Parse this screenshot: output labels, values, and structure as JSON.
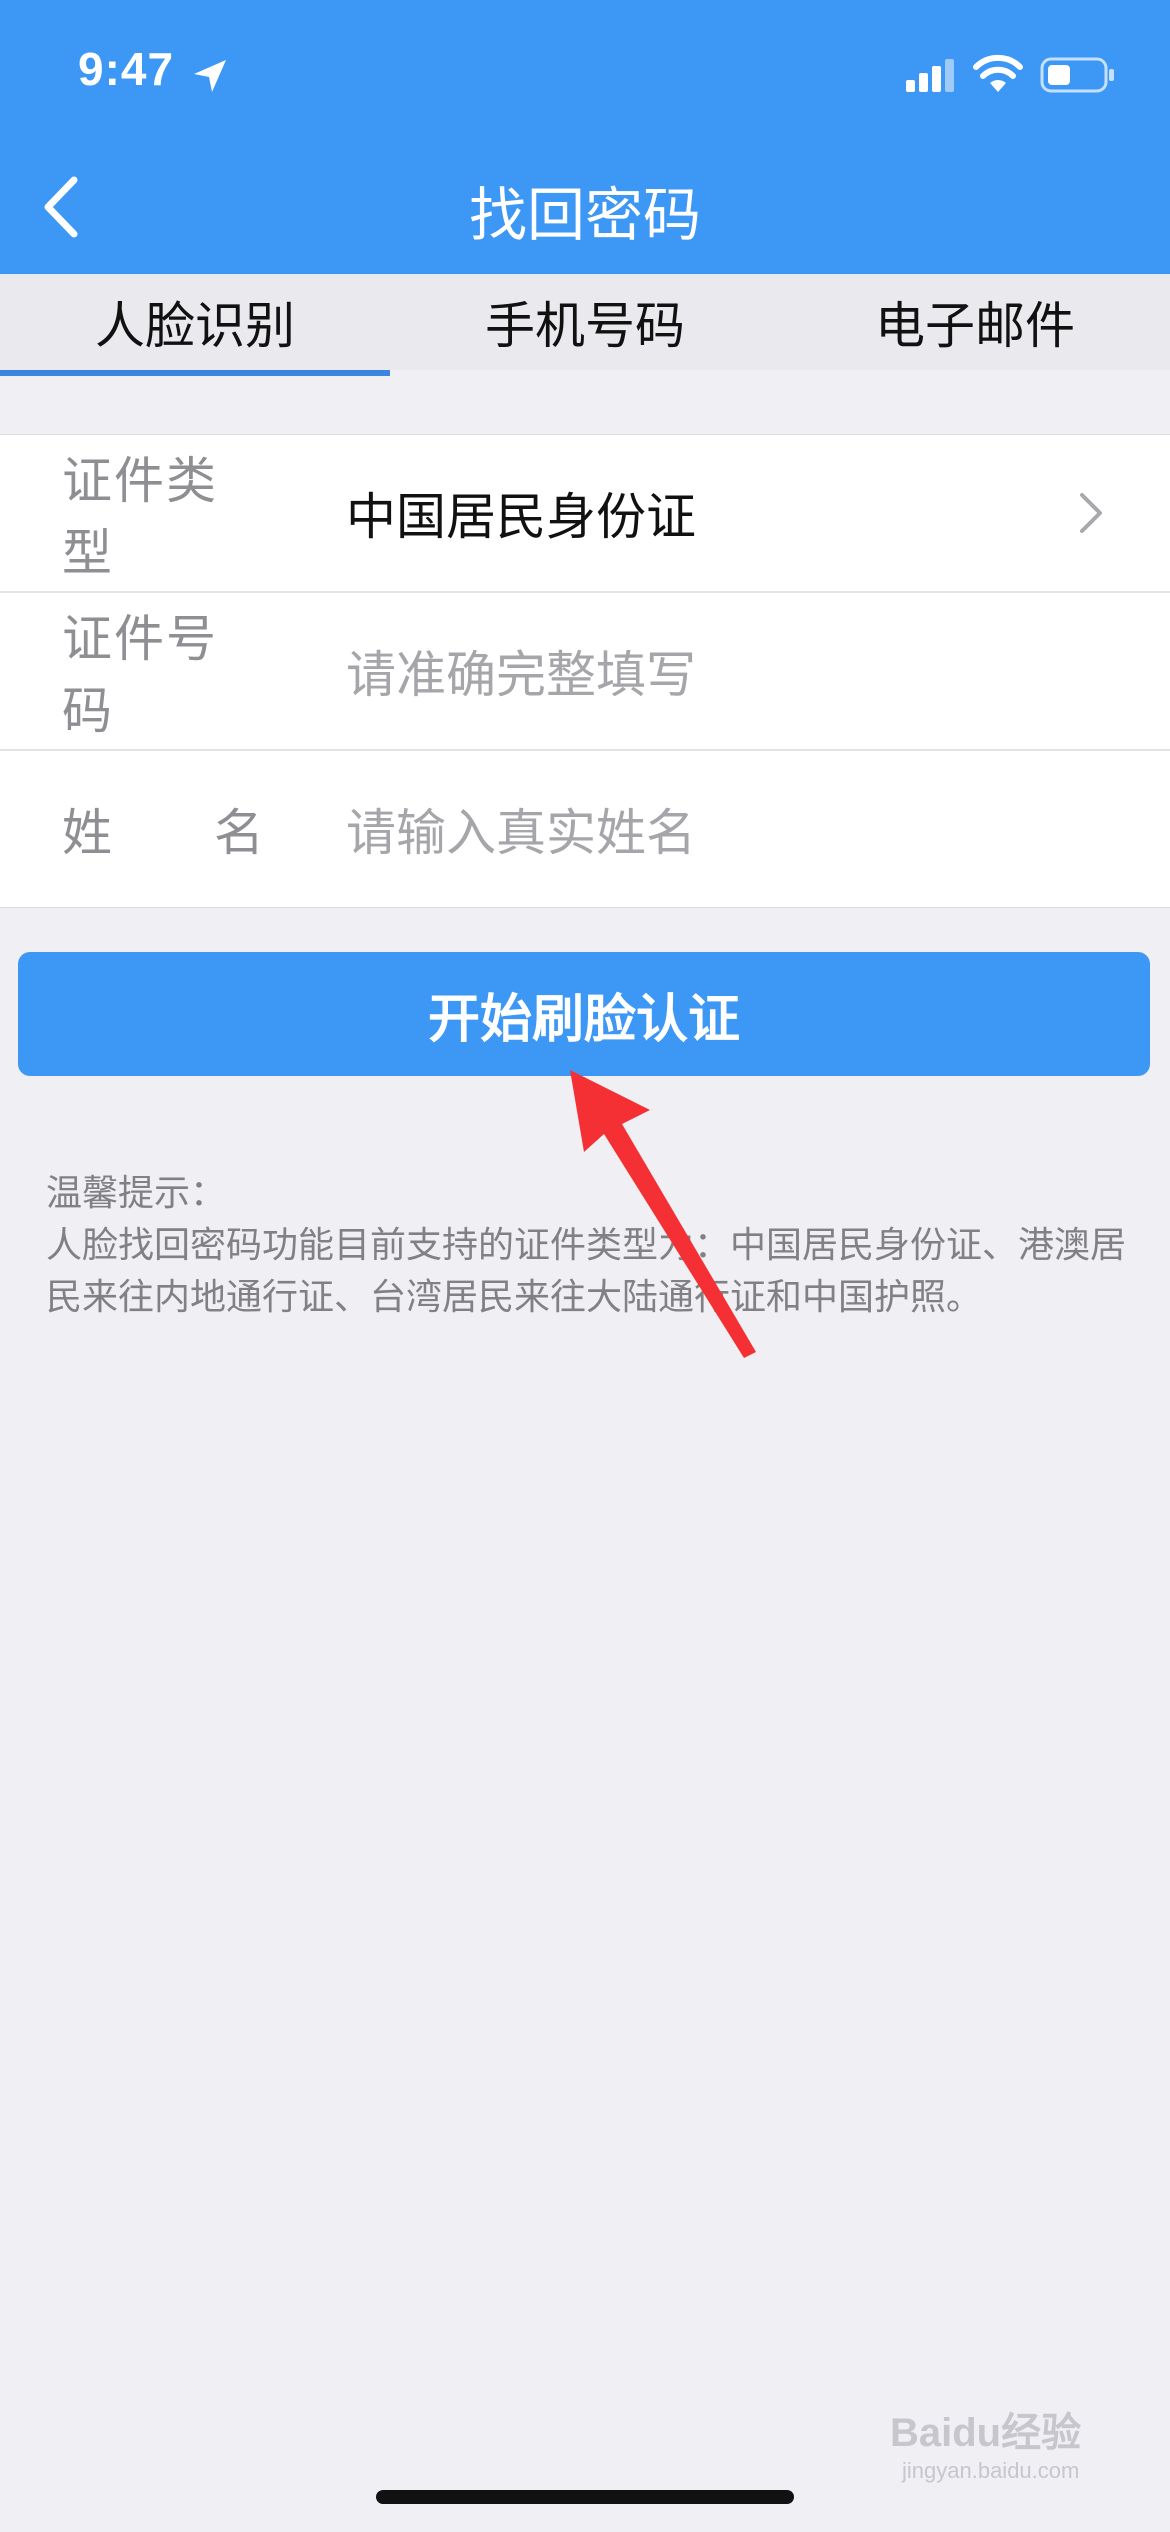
{
  "status_bar": {
    "time": "9:47"
  },
  "nav": {
    "title": "找回密码"
  },
  "tabs": [
    {
      "label": "人脸识别",
      "active": true
    },
    {
      "label": "手机号码",
      "active": false
    },
    {
      "label": "电子邮件",
      "active": false
    }
  ],
  "form": {
    "id_type": {
      "label": "证件类型",
      "value": "中国居民身份证"
    },
    "id_number": {
      "label": "证件号码",
      "placeholder": "请准确完整填写"
    },
    "name": {
      "label_first": "姓",
      "label_second": "名",
      "placeholder": "请输入真实姓名"
    }
  },
  "action": {
    "button_label": "开始刷脸认证"
  },
  "tips": {
    "title": "温馨提示：",
    "body": "人脸找回密码功能目前支持的证件类型为：中国居民身份证、港澳居民来往内地通行证、台湾居民来往大陆通行证和中国护照。"
  },
  "watermark": {
    "brand": "Baidu经验",
    "url": "jingyan.baidu.com"
  },
  "colors": {
    "accent": "#3d97f5",
    "annotation_arrow": "#f43034"
  }
}
